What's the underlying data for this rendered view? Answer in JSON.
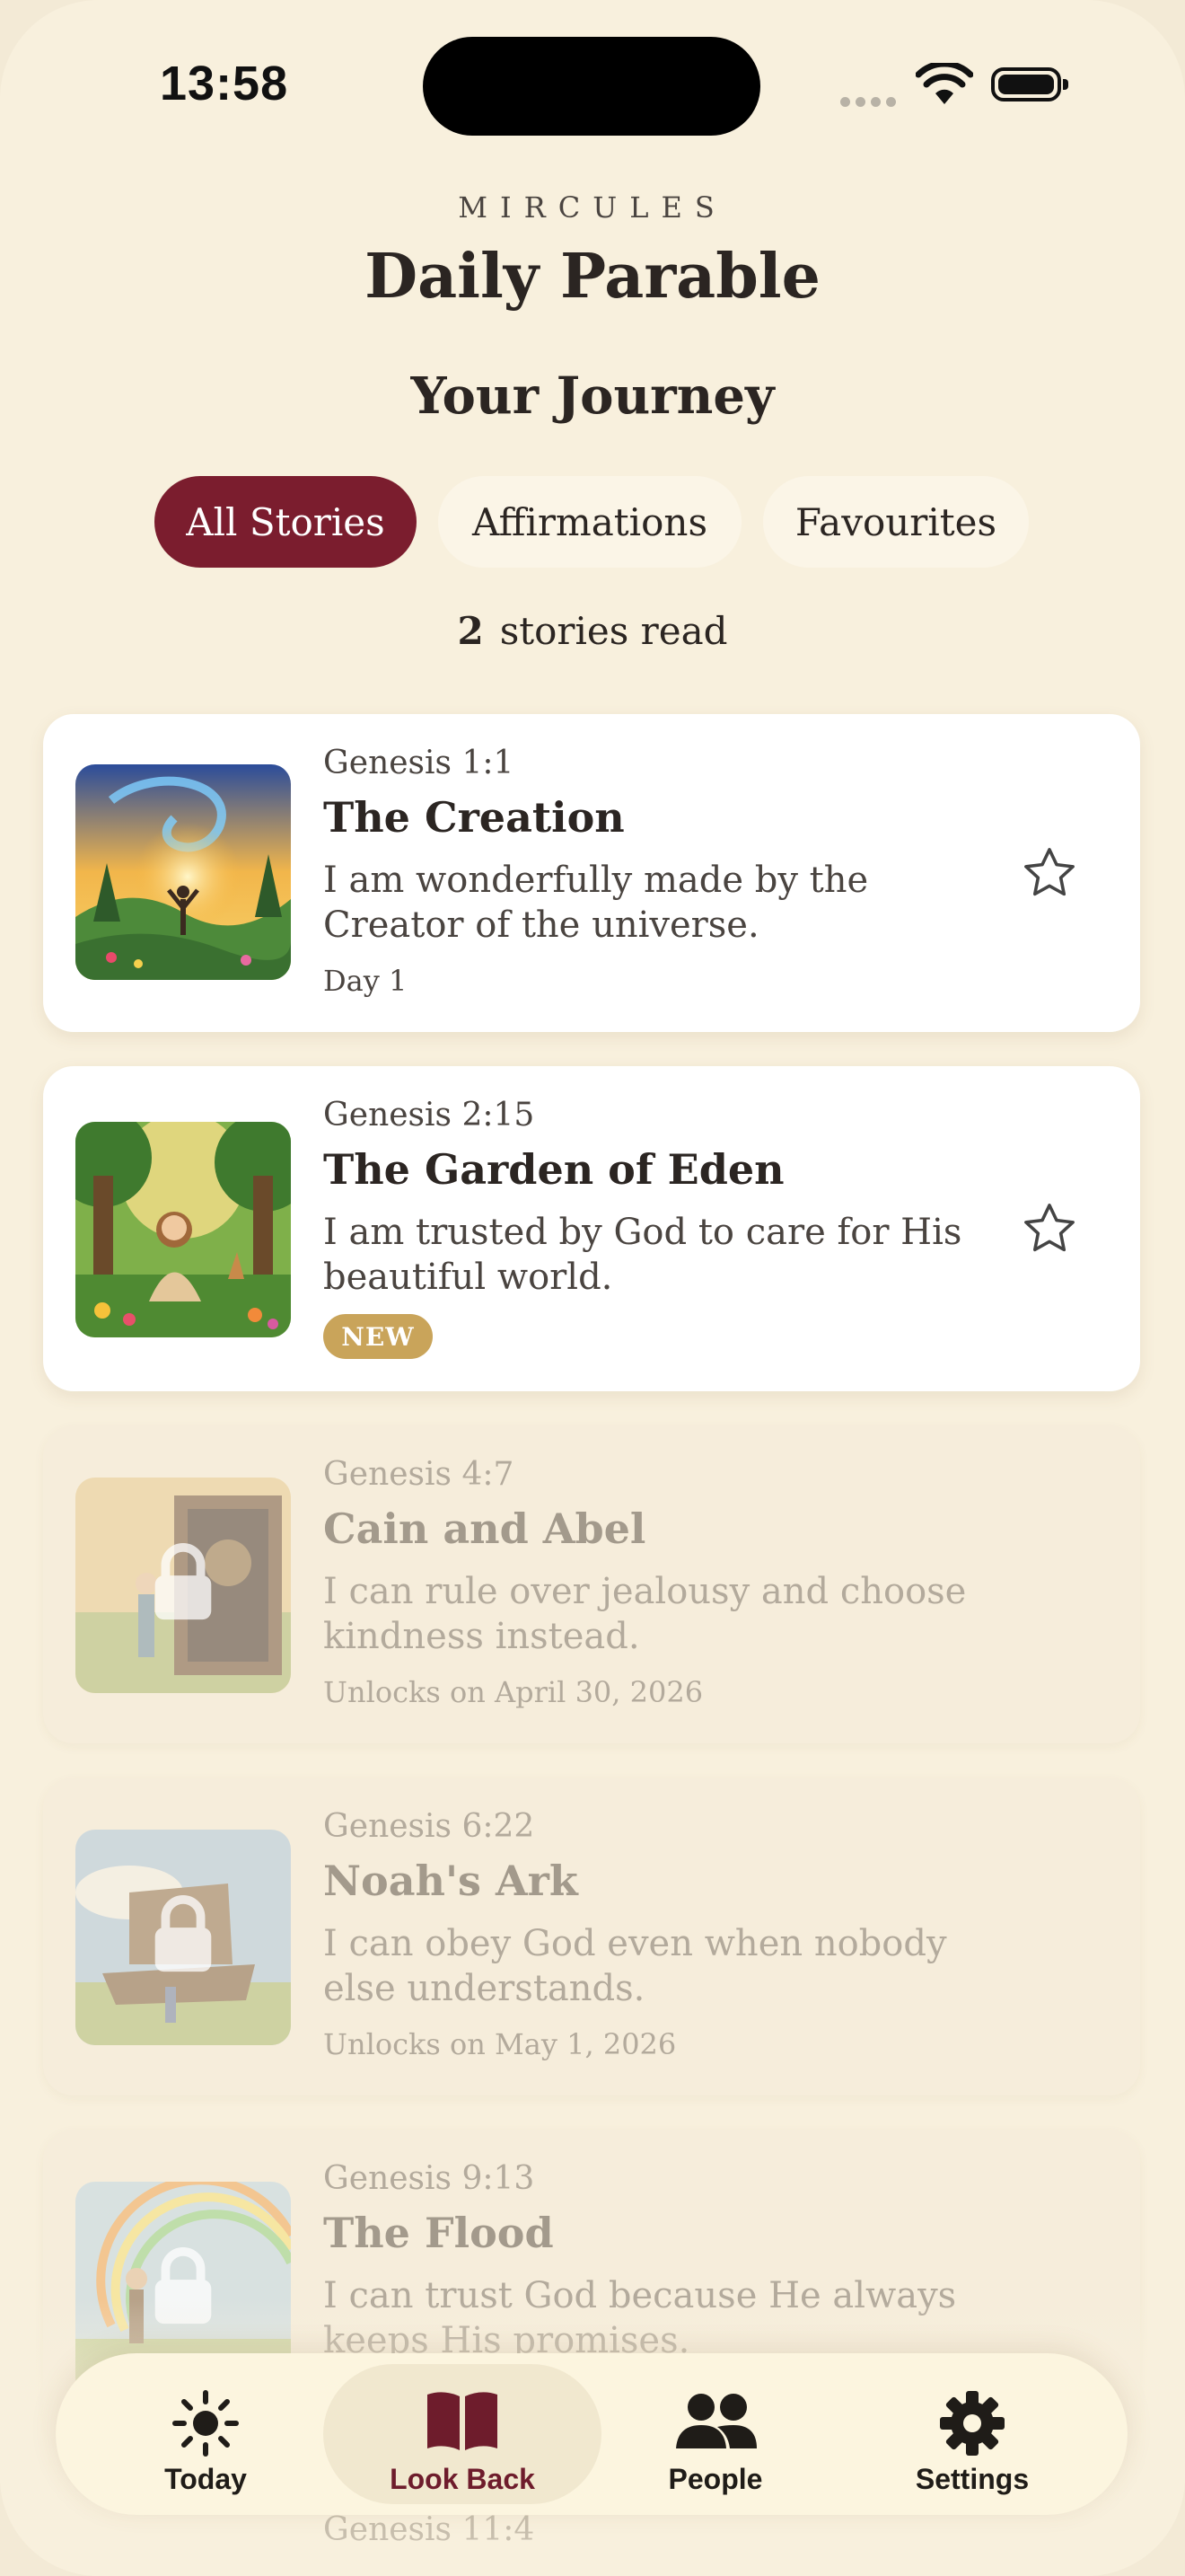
{
  "status_bar": {
    "time": "13:58"
  },
  "header": {
    "brand": "MIRCULES",
    "title": "Daily Parable",
    "section_title": "Your Journey"
  },
  "filters": {
    "tabs": [
      "All Stories",
      "Affirmations",
      "Favourites"
    ],
    "active": "All Stories"
  },
  "progress": {
    "count": "2",
    "label": "stories read"
  },
  "stories": [
    {
      "reference": "Genesis 1:1",
      "title": "The Creation",
      "affirmation": "I am wonderfully made by the Creator of the universe.",
      "status": "Day 1",
      "locked": false
    },
    {
      "reference": "Genesis 2:15",
      "title": "The Garden of Eden",
      "affirmation": "I am trusted by God to care for His beautiful world.",
      "badge": "NEW",
      "locked": false
    },
    {
      "reference": "Genesis 4:7",
      "title": "Cain and Abel",
      "affirmation": "I can rule over jealousy and choose kindness instead.",
      "status": "Unlocks on April 30, 2026",
      "locked": true
    },
    {
      "reference": "Genesis 6:22",
      "title": "Noah's Ark",
      "affirmation": "I can obey God even when nobody else understands.",
      "status": "Unlocks on May 1, 2026",
      "locked": true
    },
    {
      "reference": "Genesis 9:13",
      "title": "The Flood",
      "affirmation": "I can trust God because He always keeps His promises.",
      "locked": true
    },
    {
      "reference": "Genesis 11:4",
      "locked": true
    }
  ],
  "nav": {
    "items": [
      "Today",
      "Look Back",
      "People",
      "Settings"
    ],
    "active": "Look Back"
  },
  "colors": {
    "accent": "#7b1d2e",
    "badge": "#c9a45a",
    "background": "#f8f0dd"
  }
}
